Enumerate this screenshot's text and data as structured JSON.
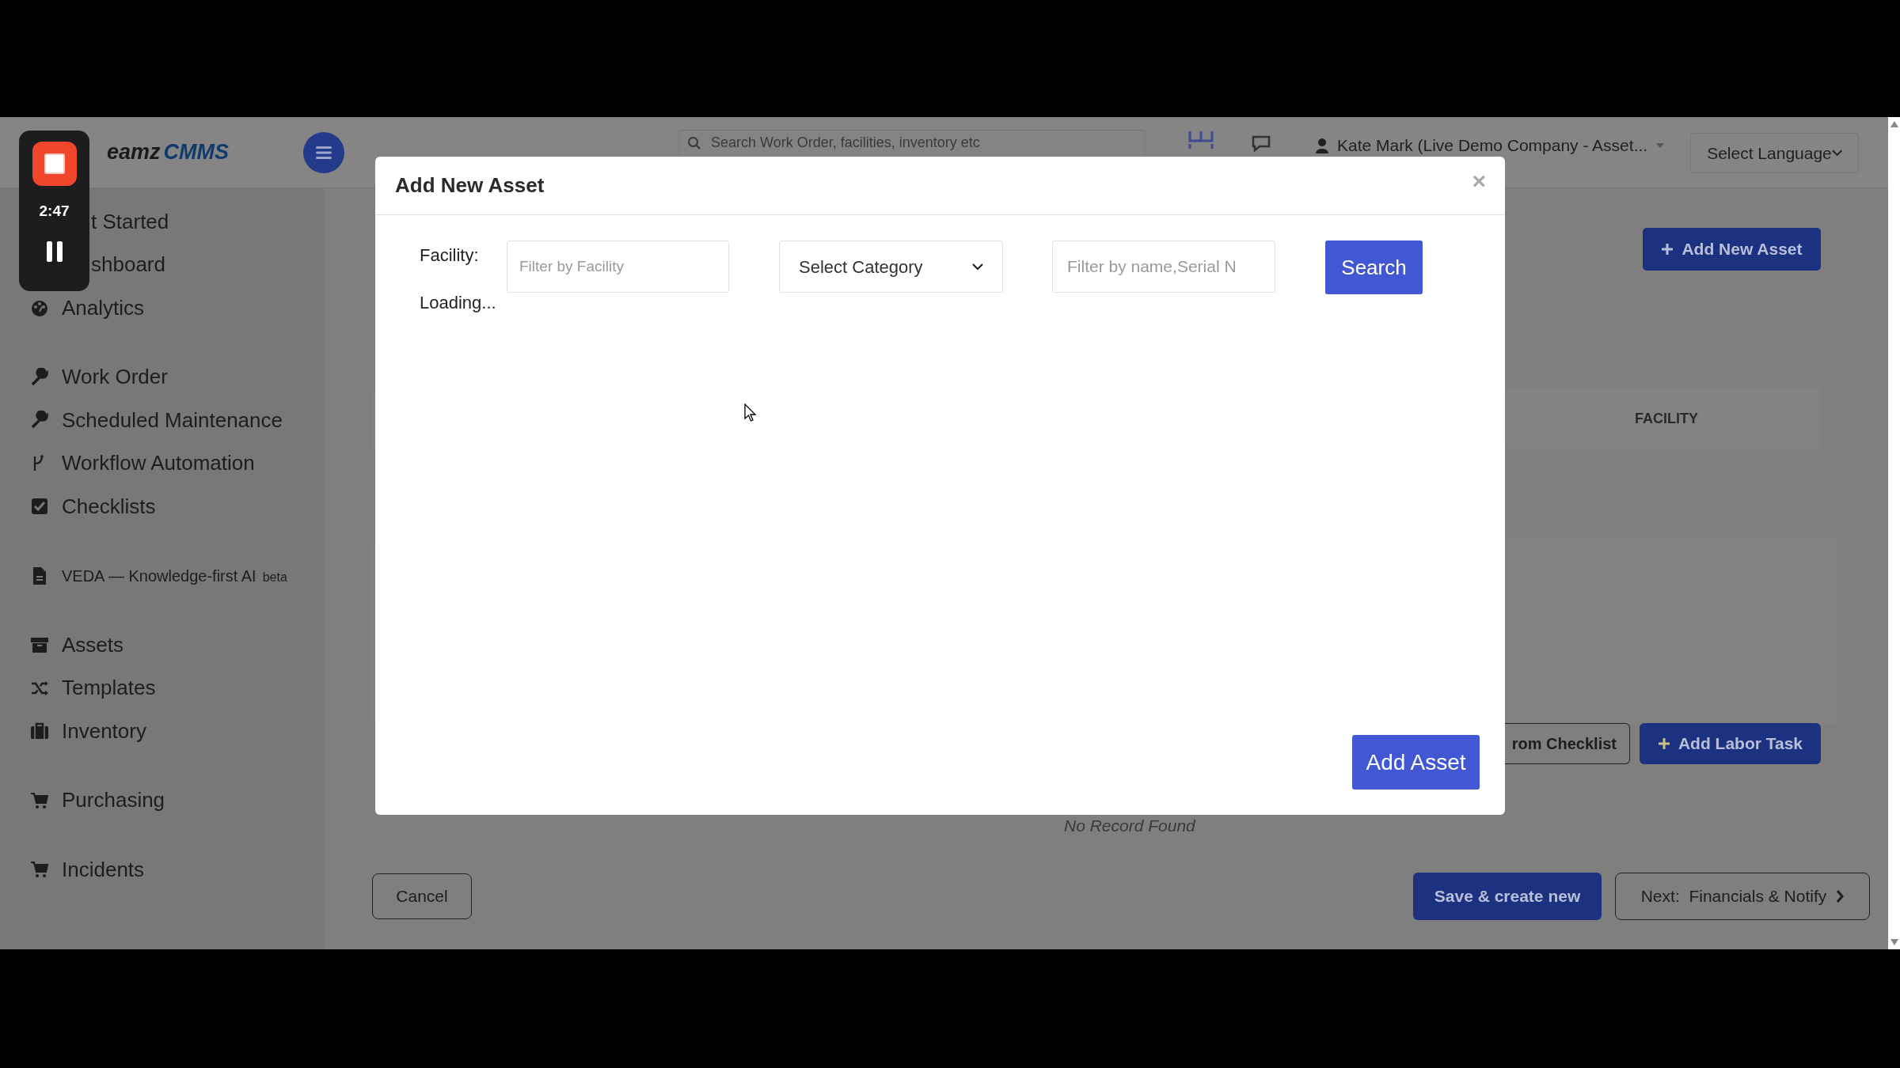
{
  "recorder": {
    "time": "2:47"
  },
  "header": {
    "logo_prefix": "eamz",
    "logo_brand": "CMMS",
    "search_placeholder": "Search Work Order, facilities, inventory etc",
    "user": "Kate Mark (Live Demo Company - Asset...",
    "language": "Select Language"
  },
  "sidebar": {
    "groups": [
      {
        "items": [
          {
            "label": "t Started"
          },
          {
            "label": "shboard"
          },
          {
            "label": "Analytics"
          }
        ]
      },
      {
        "items": [
          {
            "label": "Work Order"
          },
          {
            "label": "Scheduled Maintenance"
          },
          {
            "label": "Workflow Automation"
          },
          {
            "label": "Checklists"
          }
        ]
      },
      {
        "items": [
          {
            "label": "VEDA — Knowledge-first AI",
            "badge": "beta"
          }
        ]
      },
      {
        "items": [
          {
            "label": "Assets"
          },
          {
            "label": "Templates"
          },
          {
            "label": "Inventory"
          }
        ]
      },
      {
        "items": [
          {
            "label": "Purchasing"
          }
        ]
      },
      {
        "items": [
          {
            "label": "Incidents"
          }
        ]
      }
    ]
  },
  "page": {
    "add_button": "Add New Asset",
    "table_column": "FACILITY",
    "task_buttons": [
      {
        "label": "rom Checklist",
        "kind": "outline"
      },
      {
        "label": "Add Labor Task",
        "kind": "primary"
      }
    ],
    "empty_text": "No Record Found",
    "footer": {
      "cancel": "Cancel",
      "save": "Save & create new",
      "next": "Next:  Financials & Notify"
    }
  },
  "modal": {
    "title": "Add New Asset",
    "close": "×",
    "facility_label": "Facility:",
    "facility_placeholder": "Filter by Facility",
    "category": "Select Category",
    "name_placeholder": "Filter by name,Serial N",
    "search": "Search",
    "status": "Loading...",
    "add_button": "Add Asset"
  }
}
